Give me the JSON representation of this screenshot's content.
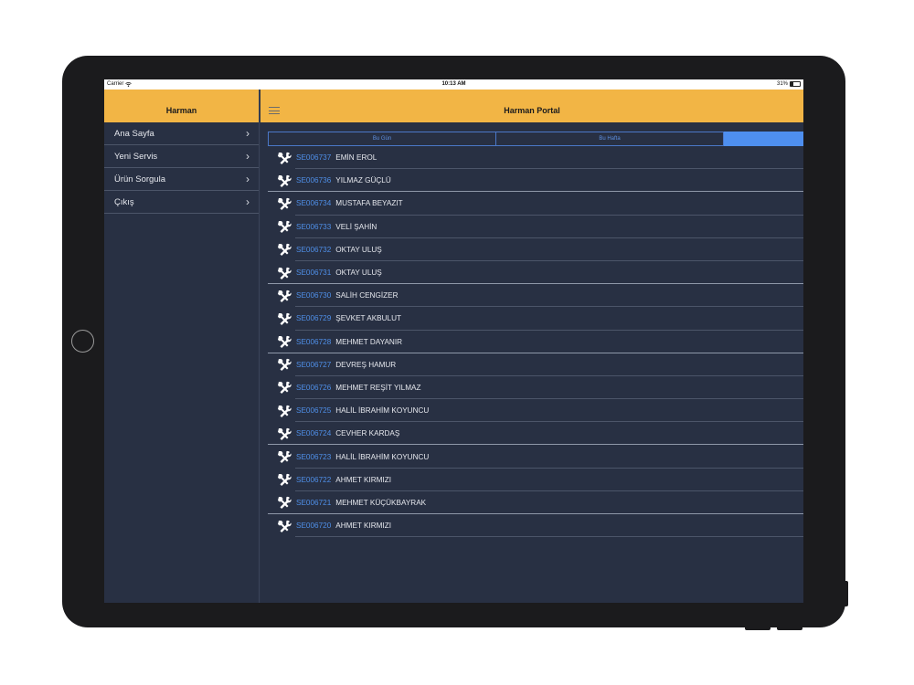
{
  "status_bar": {
    "carrier": "Carrier",
    "time": "10:13 AM",
    "battery": "31%",
    "battery_level": 0.31
  },
  "sidebar": {
    "title": "Harman",
    "items": [
      {
        "label": "Ana Sayfa"
      },
      {
        "label": "Yeni Servis"
      },
      {
        "label": "Ürün Sorgula"
      },
      {
        "label": "Çıkış"
      }
    ]
  },
  "main": {
    "title": "Harman Portal",
    "tabs": [
      {
        "label": "Bu Gün"
      },
      {
        "label": "Bu Hafta"
      },
      {
        "label": ""
      }
    ],
    "rows": [
      {
        "code": "SE006737",
        "name": "EMİN EROL"
      },
      {
        "code": "SE006736",
        "name": "YILMAZ GÜÇLÜ"
      },
      {
        "code": "SE006734",
        "name": "MUSTAFA BEYAZIT"
      },
      {
        "code": "SE006733",
        "name": "VELİ ŞAHİN"
      },
      {
        "code": "SE006732",
        "name": "OKTAY ULUŞ"
      },
      {
        "code": "SE006731",
        "name": "OKTAY ULUŞ"
      },
      {
        "code": "SE006730",
        "name": "SALİH CENGİZER"
      },
      {
        "code": "SE006729",
        "name": "ŞEVKET AKBULUT"
      },
      {
        "code": "SE006728",
        "name": "MEHMET DAYANIR"
      },
      {
        "code": "SE006727",
        "name": "DEVREŞ HAMUR"
      },
      {
        "code": "SE006726",
        "name": "MEHMET REŞİT YILMAZ"
      },
      {
        "code": "SE006725",
        "name": "HALİL İBRAHİM KOYUNCU"
      },
      {
        "code": "SE006724",
        "name": "CEVHER KARDAŞ"
      },
      {
        "code": "SE006723",
        "name": "HALİL İBRAHİM KOYUNCU"
      },
      {
        "code": "SE006722",
        "name": "AHMET KIRMIZI"
      },
      {
        "code": "SE006721",
        "name": "MEHMET KÜÇÜKBAYRAK"
      },
      {
        "code": "SE006720",
        "name": "AHMET KIRMIZI"
      }
    ]
  },
  "icons": {
    "row_icon": "tools-icon",
    "menu_icon": "hamburger-icon",
    "chevron": "chevron-right-icon"
  },
  "colors": {
    "header": "#f2b545",
    "background": "#283043",
    "accent": "#4e8ff0",
    "code_text": "#4f8fe8"
  }
}
